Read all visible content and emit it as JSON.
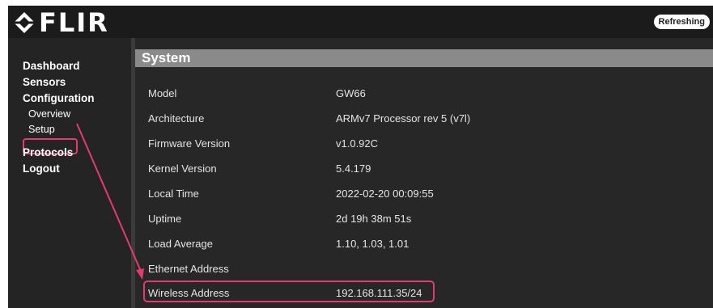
{
  "header": {
    "brand": "FLIR",
    "status_badge": "Refreshing"
  },
  "sidebar": {
    "items": [
      {
        "label": "Dashboard"
      },
      {
        "label": "Sensors"
      },
      {
        "label": "Configuration"
      },
      {
        "label": "Overview"
      },
      {
        "label": "Setup"
      },
      {
        "label": "Protocols"
      },
      {
        "label": "Logout"
      }
    ]
  },
  "main": {
    "section_title": "System",
    "rows": [
      {
        "label": "Model",
        "value": "GW66"
      },
      {
        "label": "Architecture",
        "value": "ARMv7 Processor rev 5 (v7l)"
      },
      {
        "label": "Firmware Version",
        "value": "v1.0.92C"
      },
      {
        "label": "Kernel Version",
        "value": "5.4.179"
      },
      {
        "label": "Local Time",
        "value": "2022-02-20 00:09:55"
      },
      {
        "label": "Uptime",
        "value": "2d 19h 38m 51s"
      },
      {
        "label": "Load Average",
        "value": "1.10, 1.03, 1.01"
      },
      {
        "label": "Ethernet Address",
        "value": ""
      },
      {
        "label": "Wireless Address",
        "value": "192.168.111.35/24"
      }
    ]
  },
  "colors": {
    "annotation": "#e63a6f",
    "section_bar": "#8a8a8a",
    "background": "#222222"
  },
  "icons": {
    "logo": "flir-logo-icon"
  }
}
